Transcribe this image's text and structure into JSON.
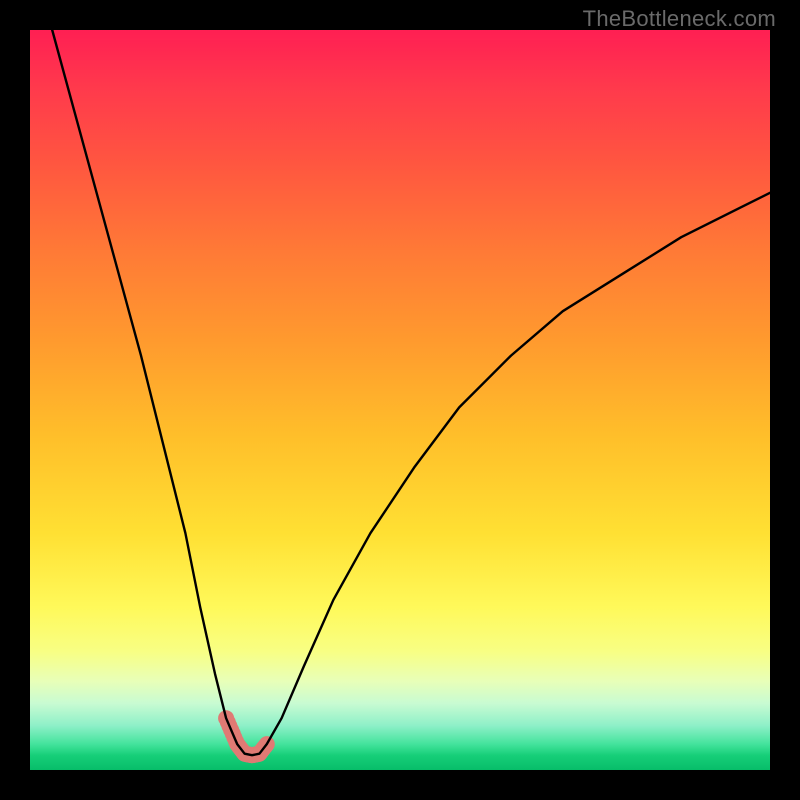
{
  "watermark": "TheBottleneck.com",
  "chart_data": {
    "type": "line",
    "title": "",
    "xlabel": "",
    "ylabel": "",
    "xlim": [
      0,
      100
    ],
    "ylim": [
      0,
      100
    ],
    "series": [
      {
        "name": "bottleneck-curve",
        "x": [
          3,
          6,
          9,
          12,
          15,
          18,
          21,
          23,
          25,
          26.5,
          28,
          29,
          30,
          31,
          32,
          34,
          37,
          41,
          46,
          52,
          58,
          65,
          72,
          80,
          88,
          96,
          100
        ],
        "values": [
          100,
          89,
          78,
          67,
          56,
          44,
          32,
          22,
          13,
          7,
          3.5,
          2.2,
          2,
          2.2,
          3.5,
          7,
          14,
          23,
          32,
          41,
          49,
          56,
          62,
          67,
          72,
          76,
          78
        ]
      }
    ],
    "highlight": {
      "name": "salmon-dots",
      "x_range": [
        26.5,
        32
      ],
      "y_range": [
        2,
        7
      ],
      "color": "#e07a74"
    },
    "gradient_stops": [
      {
        "pos": 0,
        "color": "#ff1f53"
      },
      {
        "pos": 0.5,
        "color": "#ffe033"
      },
      {
        "pos": 0.85,
        "color": "#f8ff84"
      },
      {
        "pos": 1.0,
        "color": "#07bd69"
      }
    ]
  }
}
